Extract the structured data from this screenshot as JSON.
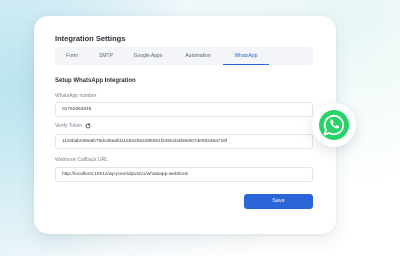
{
  "header": {
    "title": "Integration Settings"
  },
  "tabs": [
    {
      "label": "Form"
    },
    {
      "label": "SMTP"
    },
    {
      "label": "Google Apps"
    },
    {
      "label": "Automation"
    },
    {
      "label": "WhatsApp",
      "active": true
    }
  ],
  "section": {
    "title": "Setup WhatsApp Integration"
  },
  "fields": {
    "number": {
      "label": "WhatsApp number",
      "value": "01762663848"
    },
    "token": {
      "label": "Verify Token",
      "value": "1115babe38e6b76dcd6eafd115622b53285051f2450cb4b8e607de05236a718f"
    },
    "webhook": {
      "label": "Webhook Callback URL",
      "value": "http://localhost:10011/wp-json/sdpvs/v1/whatsapp-webhook"
    }
  },
  "actions": {
    "save_label": "Save"
  },
  "colors": {
    "accent": "#2b66d9",
    "whatsapp": "#25d366"
  },
  "icons": {
    "token_refresh": "refresh-icon",
    "badge": "whatsapp-icon"
  }
}
